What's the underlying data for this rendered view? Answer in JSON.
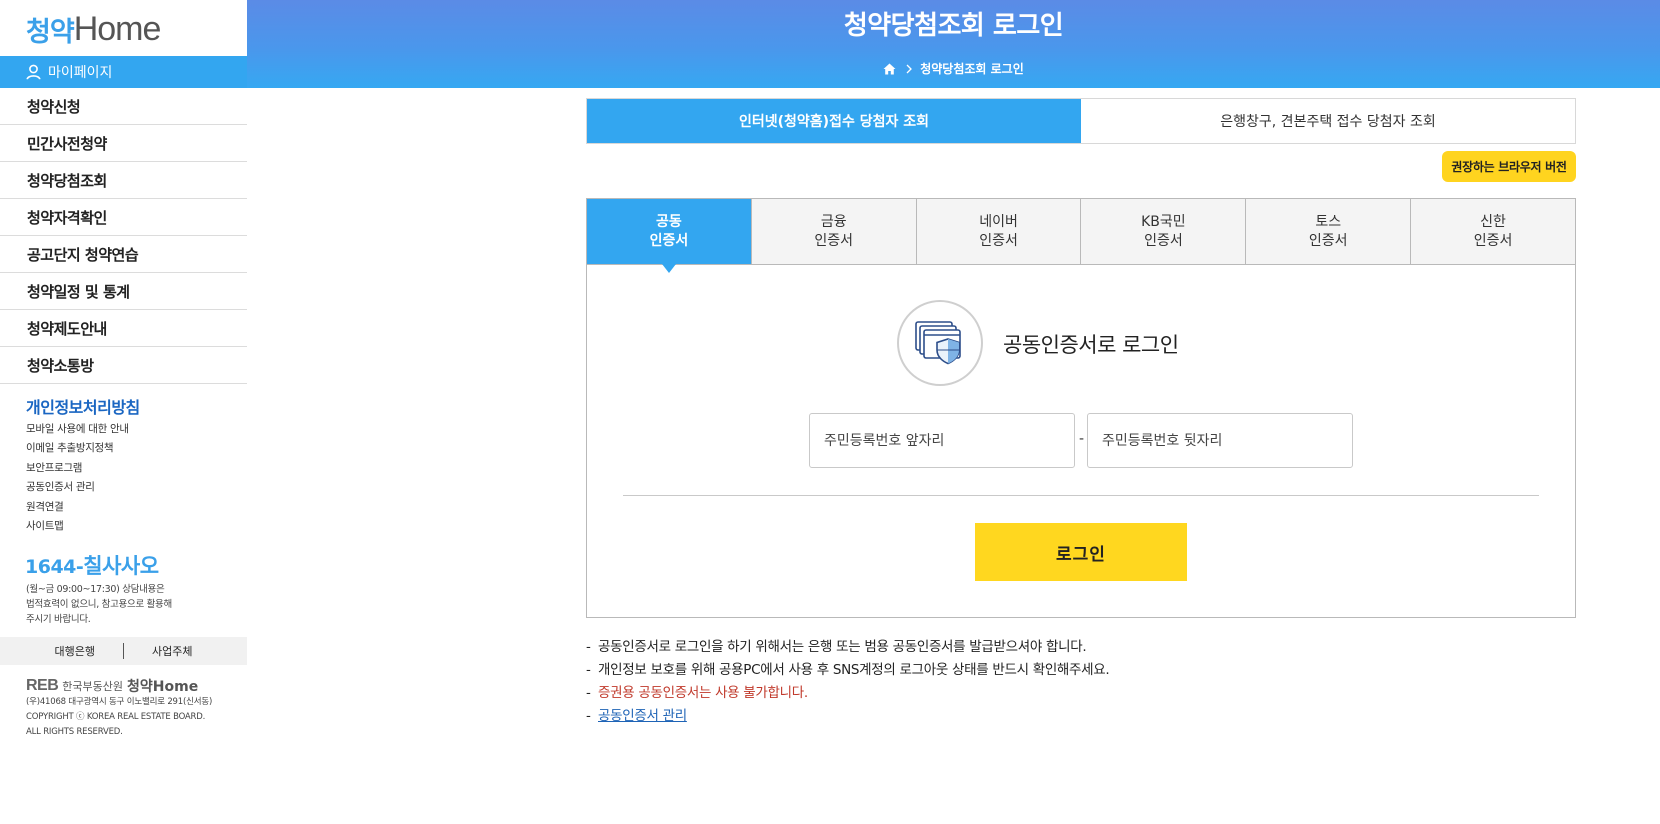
{
  "sidebar": {
    "logo_ko": "청약",
    "logo_en": "Home",
    "mypage_label": "마이페이지",
    "menu": [
      "청약신청",
      "민간사전청약",
      "청약당첨조회",
      "청약자격확인",
      "공고단지 청약연습",
      "청약일정 및 통계",
      "청약제도안내",
      "청약소통방"
    ],
    "privacy_title": "개인정보처리방침",
    "sub_links": [
      "모바일 사용에 대한 안내",
      "이메일 추출방지정책",
      "보안프로그램",
      "공동인증서 관리",
      "원격연결",
      "사이트맵"
    ],
    "phone_prefix": "1644-",
    "phone_word": "칠사사오",
    "hours_line1": "(월~금 09:00~17:30) 상담내용은",
    "hours_line2": "법적효력이 없으니, 참고용으로 활용해",
    "hours_line3": "주시기 바랍니다.",
    "bank_label": "대행은행",
    "business_label": "사업주체",
    "reb_mark": "REB",
    "reb_name": "한국부동산원",
    "reb_home": "청약Home",
    "address_line1": "(우)41068 대구광역시 동구 이노밸리로 291(신서동)",
    "address_line2": "COPYRIGHT ⓒ KOREA REAL ESTATE BOARD.",
    "address_line3": "ALL RIGHTS RESERVED."
  },
  "header": {
    "title": "청약당첨조회 로그인",
    "breadcrumb_current": "청약당첨조회 로그인"
  },
  "top_tabs": {
    "internet": "인터넷(청약홈)접수 당첨자 조회",
    "bank": "은행창구, 견본주택 접수 당첨자 조회"
  },
  "browser_button": "권장하는 브라우저 버전",
  "cert_tabs": [
    {
      "line1": "공동",
      "line2": "인증서"
    },
    {
      "line1": "금융",
      "line2": "인증서"
    },
    {
      "line1": "네이버",
      "line2": "인증서"
    },
    {
      "line1": "KB국민",
      "line2": "인증서"
    },
    {
      "line1": "토스",
      "line2": "인증서"
    },
    {
      "line1": "신한",
      "line2": "인증서"
    }
  ],
  "login": {
    "heading": "공동인증서로 로그인",
    "rrn_front_placeholder": "주민등록번호 앞자리",
    "rrn_back_placeholder": "주민등록번호 뒷자리",
    "dash": "-",
    "button": "로그인"
  },
  "notes": [
    "공동인증서로 로그인을 하기 위해서는 은행 또는 범용 공동인증서를 발급받으셔야 합니다.",
    "개인정보 보호를 위해 공용PC에서 사용 후 SNS계정의 로그아웃 상태를 반드시 확인해주세요.",
    "증권용 공동인증서는 사용 불가합니다.",
    "공동인증서 관리"
  ],
  "note_bullet": "-",
  "colors": {
    "accent_blue": "#33a6f0",
    "header_top": "#5b8be6",
    "yellow": "#ffd71f",
    "warn_red": "#c0392b",
    "link_blue": "#1e63b6",
    "privacy_blue": "#1a66c2"
  },
  "icons": {
    "mypage": "person-icon",
    "home": "home-icon",
    "breadcrumb_sep": "chevron-right-icon",
    "certificate": "certificate-shield-icon"
  }
}
